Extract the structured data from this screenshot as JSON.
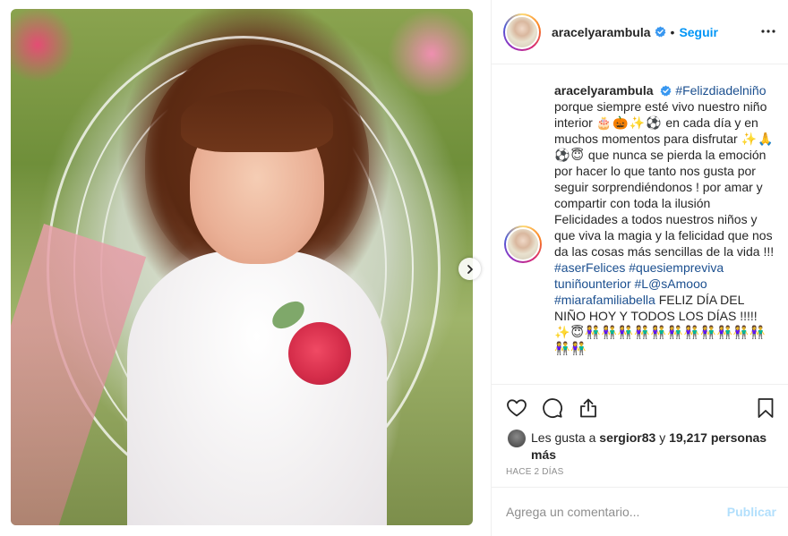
{
  "post": {
    "author": "aracelyarambula",
    "follow_label": "Seguir",
    "dot": "•",
    "caption_user": "aracelyarambula",
    "caption": {
      "hashtag1": "#Felizdiadelniño",
      "line_a": "porque siempre esté vivo nuestro niño interior",
      "emojis_a": "🎂🎃✨⚽",
      "line_b": "en cada día y en muchos momentos para disfrutar",
      "emojis_b": "✨🙏⚽😇",
      "line_c": "que nunca se pierda la emoción por hacer lo que tanto nos gusta por seguir sorprendiéndonos ! por amar y compartir con toda la ilusión Felicidades a todos nuestros niños y que viva la magia y la felicidad que nos da las cosas más sencillas de la vida !!!",
      "hashtag2": "#aserFelices",
      "hashtag3": "#quesiempreviva tuniñounterior",
      "hashtag4": "#L@sAmooo",
      "hashtag5": "#miarafamiliabella",
      "line_d": "FELIZ DÍA DEL NIÑO HOY Y TODOS LOS DÍAS !!!!!",
      "emojis_d": "✨😇👫👫👫👫👫👫👫👫👫👫👫👫👫"
    },
    "likes": {
      "prefix": "Les gusta a",
      "user": "sergior83",
      "joiner": "y",
      "count": "19,217 personas más"
    },
    "time": "HACE 2 DÍAS",
    "comment_placeholder": "Agrega un comentario...",
    "publish_label": "Publicar"
  },
  "icons": {
    "verified": "verified-badge-icon",
    "more": "more-options-icon",
    "like": "heart-icon",
    "comment": "comment-icon",
    "share": "share-icon",
    "save": "bookmark-icon",
    "next": "chevron-right-icon"
  },
  "colors": {
    "accent": "#0095f6",
    "hashtag": "#1b4f8f",
    "muted": "#8e8e8e",
    "publish_disabled": "#b2dffc"
  }
}
